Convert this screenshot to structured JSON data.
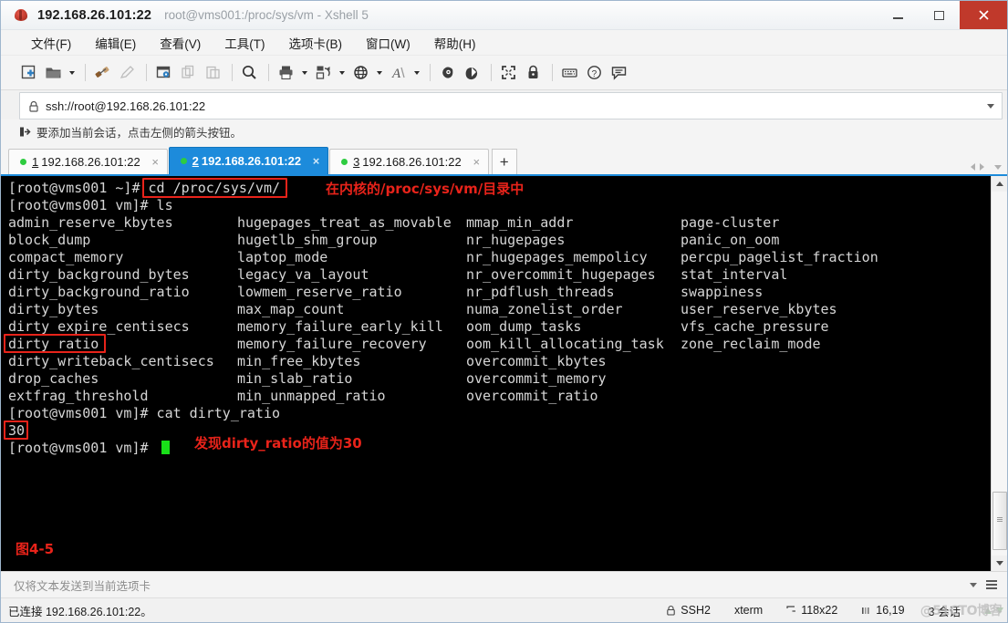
{
  "window": {
    "host_title": "192.168.26.101:22",
    "subtitle": "root@vms001:/proc/sys/vm - Xshell 5",
    "app_icon": "xshell-bug-icon",
    "minimize_label": "—",
    "maximize_label": "□",
    "close_label": "✕"
  },
  "menubar": {
    "items": [
      {
        "label": "文件(F)",
        "name": "menu-file"
      },
      {
        "label": "编辑(E)",
        "name": "menu-edit"
      },
      {
        "label": "查看(V)",
        "name": "menu-view"
      },
      {
        "label": "工具(T)",
        "name": "menu-tools"
      },
      {
        "label": "选项卡(B)",
        "name": "menu-tabs"
      },
      {
        "label": "窗口(W)",
        "name": "menu-window"
      },
      {
        "label": "帮助(H)",
        "name": "menu-help"
      }
    ]
  },
  "toolbar": {
    "icons": [
      "new-session-icon",
      "open-folder-icon",
      "transfer-file-icon",
      "edit-icon",
      "properties-icon",
      "copy-icon",
      "paste-icon",
      "find-icon",
      "print-icon",
      "log-icon",
      "globe-icon",
      "font-icon",
      "sftp-icon",
      "tunnel-icon",
      "fullscreen-icon",
      "lock-icon",
      "keyboard-icon",
      "help-icon",
      "comment-icon"
    ]
  },
  "address_bar": {
    "value": "ssh://root@192.168.26.101:22",
    "lock_icon": "lock-icon",
    "dropdown_icon": "chevron-down-icon"
  },
  "hint_bar": {
    "icon": "arrow-add-icon",
    "text": "要添加当前会话，点击左侧的箭头按钮。"
  },
  "tabs": {
    "items": [
      {
        "num": "1",
        "label": "192.168.26.101:22",
        "active": false,
        "close_label": "×"
      },
      {
        "num": "2",
        "label": "192.168.26.101:22",
        "active": true,
        "close_label": "×"
      },
      {
        "num": "3",
        "label": "192.168.26.101:22",
        "active": false,
        "close_label": "×"
      }
    ],
    "new_tab_label": "+"
  },
  "terminal": {
    "prompt_line_1": "[root@vms001 ~]# cd /proc/sys/vm/",
    "prompt_1_prefix": "[root@vms001 ~]# ",
    "prompt_1_command": "cd /proc/sys/vm/",
    "prompt_line_2": "[root@vms001 vm]# ls",
    "ls_columns": [
      [
        "admin_reserve_kbytes",
        "block_dump",
        "compact_memory",
        "dirty_background_bytes",
        "dirty_background_ratio",
        "dirty_bytes",
        "dirty_expire_centisecs",
        "dirty_ratio",
        "dirty_writeback_centisecs",
        "drop_caches",
        "extfrag_threshold"
      ],
      [
        "hugepages_treat_as_movable",
        "hugetlb_shm_group",
        "laptop_mode",
        "legacy_va_layout",
        "lowmem_reserve_ratio",
        "max_map_count",
        "memory_failure_early_kill",
        "memory_failure_recovery",
        "min_free_kbytes",
        "min_slab_ratio",
        "min_unmapped_ratio"
      ],
      [
        "mmap_min_addr",
        "nr_hugepages",
        "nr_hugepages_mempolicy",
        "nr_overcommit_hugepages",
        "nr_pdflush_threads",
        "numa_zonelist_order",
        "oom_dump_tasks",
        "oom_kill_allocating_task",
        "overcommit_kbytes",
        "overcommit_memory",
        "overcommit_ratio"
      ],
      [
        "page-cluster",
        "panic_on_oom",
        "percpu_pagelist_fraction",
        "stat_interval",
        "swappiness",
        "user_reserve_kbytes",
        "vfs_cache_pressure",
        "zone_reclaim_mode"
      ]
    ],
    "cat_line": "[root@vms001 vm]# cat dirty_ratio",
    "cat_output": "30",
    "final_prompt": "[root@vms001 vm]# ",
    "annotation_1": "在内核的/proc/sys/vm/目录中",
    "annotation_2": "发现dirty_ratio的值为30",
    "figure_caption": "图4-5",
    "highlight_color": "#e8231a",
    "cursor_color": "#19e019"
  },
  "send_bar": {
    "placeholder": "仅将文本发送到当前选项卡",
    "dropdown_icon": "chevron-down-icon",
    "menu_icon": "hamburger-icon"
  },
  "statusbar": {
    "connection": "已连接 192.168.26.101:22。",
    "protocol": "SSH2",
    "protocol_icon": "lock-icon",
    "terminal_type": "xterm",
    "size": "118x22",
    "size_icon": "resize-icon",
    "cursor_pos": "16,19",
    "cursor_icon": "cursor-pos-icon",
    "sessions": "3 会话",
    "watermark": "@51CTO博客"
  }
}
